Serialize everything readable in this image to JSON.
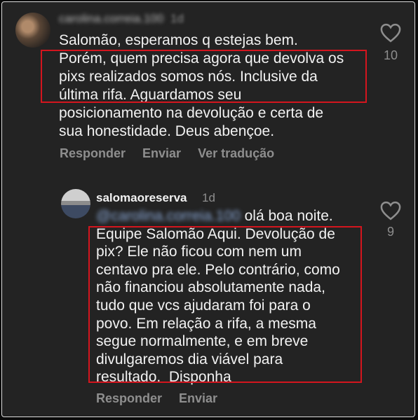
{
  "comment1": {
    "username": "carolina.correia.100",
    "time": "1d",
    "text_lines": [
      "Salomão, esperamos q estejas bem.",
      "Porém, quem precisa agora que devolva os",
      "pixs realizados somos nós. Inclusive da",
      "última rifa. Aguardamos seu",
      "posicionamento na devolução e certa de",
      "sua honestidade. Deus abençoe."
    ],
    "actions": [
      "Responder",
      "Enviar",
      "Ver tradução"
    ],
    "likes": "10"
  },
  "reply": {
    "username": "salomaoreserva",
    "time": "1d",
    "mention": "@carolina.correia.100",
    "first_line_rest": " olá boa noite.",
    "text_lines": [
      "Equipe Salomão Aqui. Devolução de",
      "pix? Ele não ficou com nem um",
      "centavo pra ele. Pelo contrário, como",
      "não financiou absolutamente nada,",
      "tudo que vcs ajudaram foi para o",
      "povo. Em relação a rifa, a mesma",
      "segue normalmente, e em breve",
      "divulgaremos dia viável para",
      "resultado.  Disponha"
    ],
    "actions": [
      "Responder",
      "Enviar"
    ],
    "likes": "9"
  },
  "colors": {
    "background": "#232323",
    "text": "#f2f2f2",
    "muted": "#8e8e8e",
    "highlight": "#d4151e"
  },
  "icons": [
    "heart-icon"
  ]
}
